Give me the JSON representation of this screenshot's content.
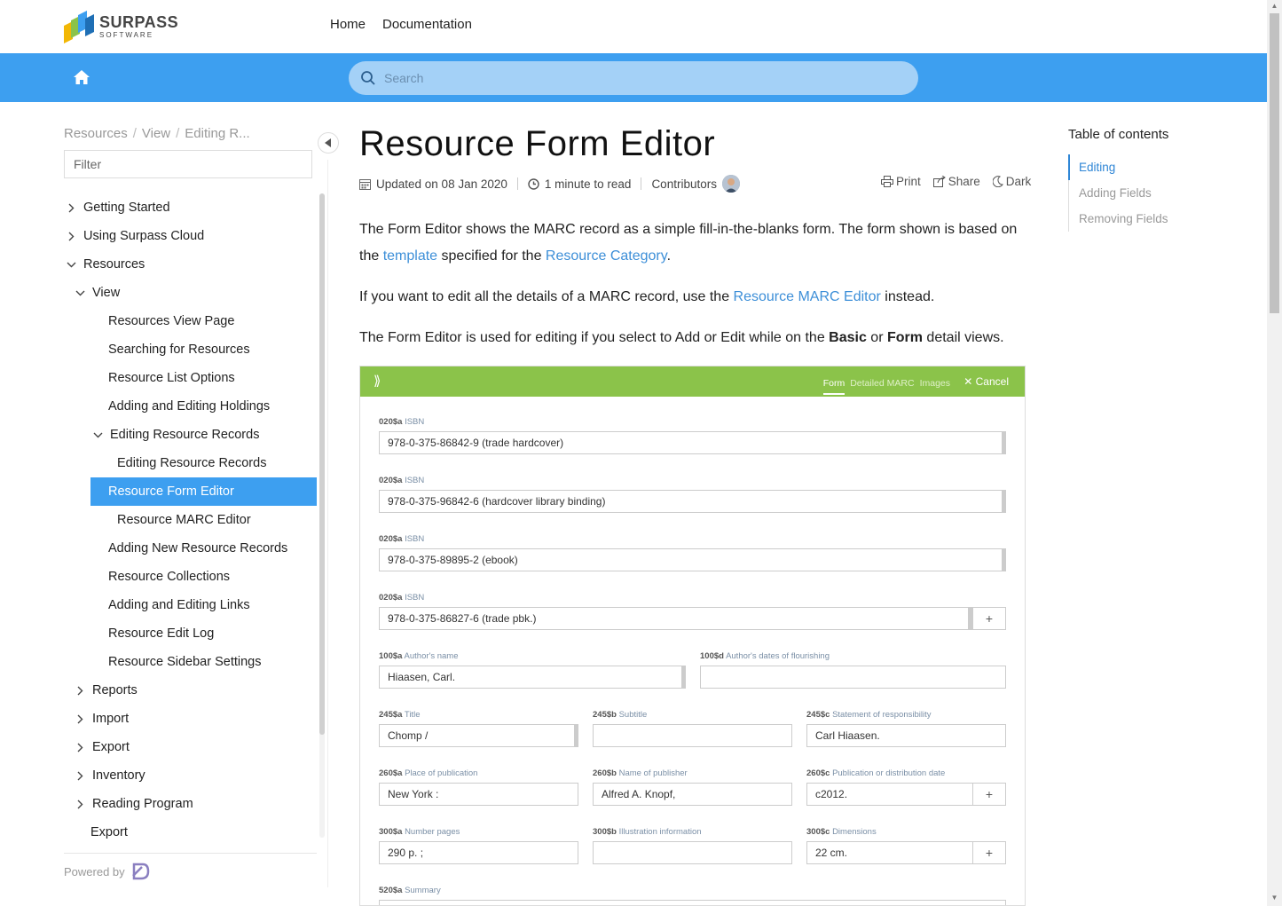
{
  "brand": {
    "name": "SURPASS",
    "sub": "SOFTWARE"
  },
  "topnav": [
    "Home",
    "Documentation"
  ],
  "search": {
    "placeholder": "Search"
  },
  "breadcrumb": [
    "Resources",
    "View",
    "Editing R..."
  ],
  "filter": {
    "placeholder": "Filter"
  },
  "nav": [
    {
      "label": "Getting Started",
      "level": 0,
      "chev": "right"
    },
    {
      "label": "Using Surpass Cloud",
      "level": 0,
      "chev": "right"
    },
    {
      "label": "Resources",
      "level": 0,
      "chev": "down"
    },
    {
      "label": "View",
      "level": 1,
      "chev": "down"
    },
    {
      "label": "Resources View Page",
      "level": 2,
      "chev": ""
    },
    {
      "label": "Searching for Resources",
      "level": 2,
      "chev": ""
    },
    {
      "label": "Resource List Options",
      "level": 2,
      "chev": ""
    },
    {
      "label": "Adding and Editing Holdings",
      "level": 2,
      "chev": ""
    },
    {
      "label": "Editing Resource Records",
      "level": 2,
      "chev": "down"
    },
    {
      "label": "Editing Resource Records",
      "level": 3,
      "chev": ""
    },
    {
      "label": "Resource Form Editor",
      "level": 3,
      "chev": "",
      "active": true
    },
    {
      "label": "Resource MARC Editor",
      "level": 3,
      "chev": ""
    },
    {
      "label": "Adding New Resource Records",
      "level": 2,
      "chev": ""
    },
    {
      "label": "Resource Collections",
      "level": 2,
      "chev": ""
    },
    {
      "label": "Adding and Editing Links",
      "level": 2,
      "chev": ""
    },
    {
      "label": "Resource Edit Log",
      "level": 2,
      "chev": ""
    },
    {
      "label": "Resource Sidebar Settings",
      "level": 2,
      "chev": ""
    },
    {
      "label": "Reports",
      "level": 1,
      "chev": "right"
    },
    {
      "label": "Import",
      "level": 1,
      "chev": "right"
    },
    {
      "label": "Export",
      "level": 1,
      "chev": "right"
    },
    {
      "label": "Inventory",
      "level": 1,
      "chev": "right"
    },
    {
      "label": "Reading Program",
      "level": 1,
      "chev": "right"
    },
    {
      "label": "Export",
      "level": 1,
      "chev": ""
    }
  ],
  "powered_by": "Powered by",
  "article": {
    "title": "Resource Form Editor",
    "updated": "Updated on 08 Jan 2020",
    "read_time": "1 minute to read",
    "contributors": "Contributors",
    "actions": {
      "print": "Print",
      "share": "Share",
      "dark": "Dark"
    },
    "p1": {
      "a": "The Form Editor shows the MARC record as a simple fill-in-the-blanks form. The form shown is based on the ",
      "link1": "template",
      "b": " specified for the ",
      "link2": "Resource Category",
      "c": "."
    },
    "p2": {
      "a": "If you want to edit all the details of a MARC record, use the ",
      "link": "Resource MARC Editor",
      "b": " instead."
    },
    "p3": {
      "a": "The Form Editor is used for editing if you select to Add or Edit while on the ",
      "b1": "Basic",
      "mid": " or ",
      "b2": "Form",
      "c": " detail views."
    }
  },
  "screenshot": {
    "tabs": [
      "Form",
      "Detailed MARC",
      "Images"
    ],
    "cancel": "Cancel",
    "isbn": [
      {
        "tag": "020$a",
        "name": "ISBN",
        "value": "978-0-375-86842-9 (trade hardcover)"
      },
      {
        "tag": "020$a",
        "name": "ISBN",
        "value": "978-0-375-96842-6 (hardcover library binding)"
      },
      {
        "tag": "020$a",
        "name": "ISBN",
        "value": "978-0-375-89895-2 (ebook)"
      },
      {
        "tag": "020$a",
        "name": "ISBN",
        "value": "978-0-375-86827-6 (trade pbk.)"
      }
    ],
    "author": {
      "tag": "100$a",
      "name": "Author's name",
      "value": "Hiaasen, Carl."
    },
    "flourish": {
      "tag": "100$d",
      "name": "Author's dates of flourishing",
      "value": ""
    },
    "title": {
      "tag": "245$a",
      "name": "Title",
      "value": "Chomp /"
    },
    "subtitle": {
      "tag": "245$b",
      "name": "Subtitle",
      "value": ""
    },
    "resp": {
      "tag": "245$c",
      "name": "Statement of responsibility",
      "value": "Carl Hiaasen."
    },
    "place": {
      "tag": "260$a",
      "name": "Place of publication",
      "value": "New York :"
    },
    "publisher": {
      "tag": "260$b",
      "name": "Name of publisher",
      "value": "Alfred A. Knopf,"
    },
    "date": {
      "tag": "260$c",
      "name": "Publication or distribution date",
      "value": "c2012."
    },
    "pages": {
      "tag": "300$a",
      "name": "Number pages",
      "value": "290 p. ;"
    },
    "illus": {
      "tag": "300$b",
      "name": "Illustration information",
      "value": ""
    },
    "dims": {
      "tag": "300$c",
      "name": "Dimensions",
      "value": "22 cm."
    },
    "summary": {
      "tag": "520$a",
      "name": "Summary"
    }
  },
  "toc": {
    "title": "Table of contents",
    "items": [
      "Editing",
      "Adding Fields",
      "Removing Fields"
    ]
  },
  "colors": {
    "accent": "#3d9ff0",
    "link": "#3d8fd8",
    "form_bar": "#8bc34a"
  }
}
